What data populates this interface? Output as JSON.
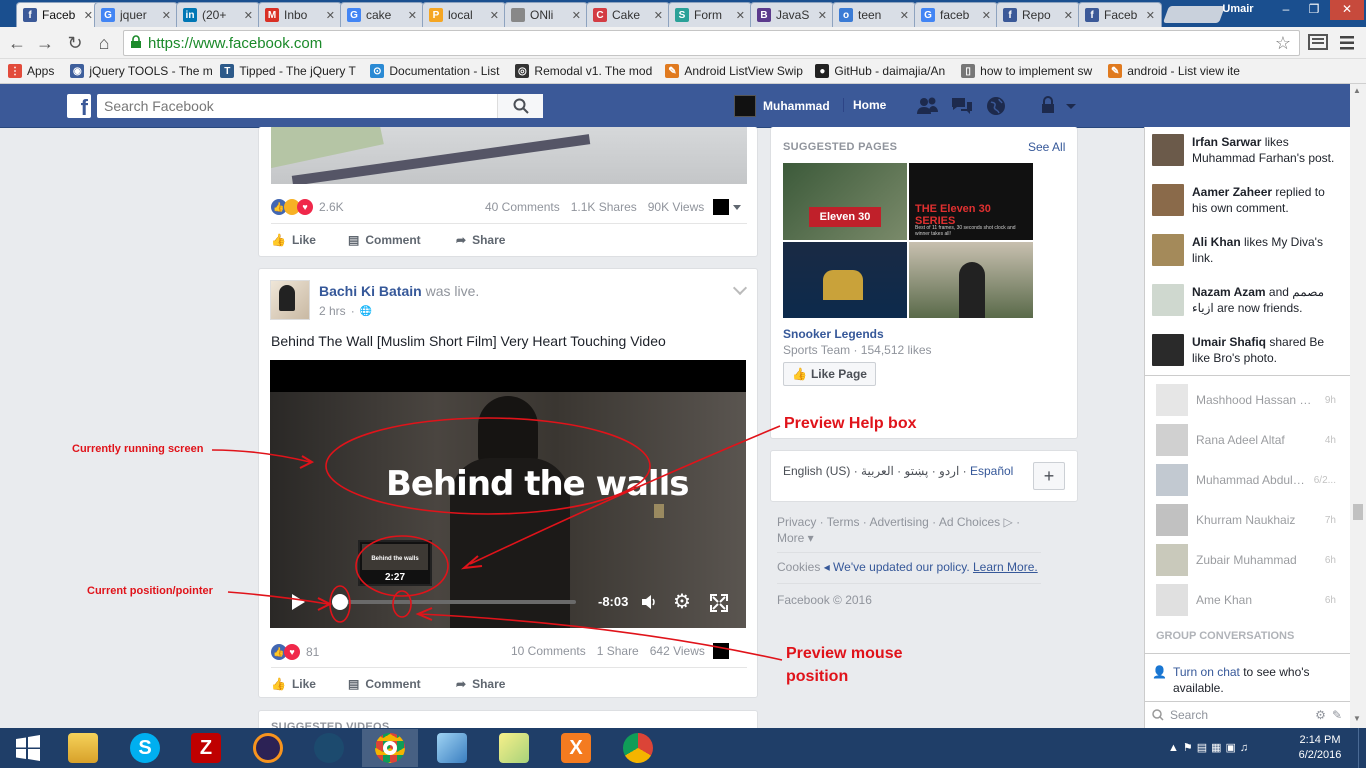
{
  "browser": {
    "tabs": [
      {
        "label": "Faceb",
        "icon": "facebook-icon",
        "color": "#3b5998",
        "glyph": "f"
      },
      {
        "label": "jquer",
        "icon": "google-icon",
        "color": "#4285f4",
        "glyph": "G"
      },
      {
        "label": "(20+",
        "icon": "linkedin-icon",
        "color": "#0077b5",
        "glyph": "in"
      },
      {
        "label": "Inbo",
        "icon": "gmail-icon",
        "color": "#d93025",
        "glyph": "M"
      },
      {
        "label": "cake",
        "icon": "google-icon",
        "color": "#4285f4",
        "glyph": "G"
      },
      {
        "label": "local",
        "icon": "phpmyadmin-icon",
        "color": "#f5a623",
        "glyph": "P"
      },
      {
        "label": "ONli",
        "icon": "document-icon",
        "color": "#888888",
        "glyph": ""
      },
      {
        "label": "Cake",
        "icon": "cakephp-icon",
        "color": "#d33c43",
        "glyph": "C"
      },
      {
        "label": "Form",
        "icon": "form-icon",
        "color": "#2aa198",
        "glyph": "S"
      },
      {
        "label": "JavaS",
        "icon": "javascript-icon",
        "color": "#5b3a8c",
        "glyph": "B"
      },
      {
        "label": "teen",
        "icon": "teen-icon",
        "color": "#3a7bd5",
        "glyph": "o"
      },
      {
        "label": "faceb",
        "icon": "google-icon",
        "color": "#4285f4",
        "glyph": "G"
      },
      {
        "label": "Repo",
        "icon": "facebook-icon",
        "color": "#3b5998",
        "glyph": "f"
      },
      {
        "label": "Faceb",
        "icon": "facebook-icon",
        "color": "#3b5998",
        "glyph": "f"
      }
    ],
    "profile_name": "Umair",
    "url": "https://www.facebook.com",
    "bookmarks": [
      {
        "label": "Apps",
        "color": "#e24b3b",
        "glyph": "⋮"
      },
      {
        "label": "jQuery TOOLS - The m",
        "color": "#3e5f9c",
        "glyph": "◉"
      },
      {
        "label": "Tipped - The jQuery T",
        "color": "#2d5a8a",
        "glyph": "T"
      },
      {
        "label": "Documentation - List",
        "color": "#2a8ad4",
        "glyph": "⊙"
      },
      {
        "label": "Remodal v1. The mod",
        "color": "#333333",
        "glyph": "◎"
      },
      {
        "label": "Android ListView Swip",
        "color": "#e07a1f",
        "glyph": "✎"
      },
      {
        "label": "GitHub - daimajia/An",
        "color": "#222222",
        "glyph": "●"
      },
      {
        "label": "how to implement sw",
        "color": "#777777",
        "glyph": "▯"
      },
      {
        "label": "android - List view ite",
        "color": "#e07a1f",
        "glyph": "✎"
      }
    ]
  },
  "fb": {
    "search_placeholder": "Search Facebook",
    "user_name": "Muhammad",
    "home_label": "Home"
  },
  "post1": {
    "reactions_count": "2.6K",
    "comments": "40 Comments",
    "shares": "1.1K Shares",
    "views": "90K Views",
    "like": "Like",
    "comment": "Comment",
    "share": "Share"
  },
  "post2": {
    "author": "Bachi Ki Batain",
    "status": "was live.",
    "time": "2 hrs",
    "text": "Behind The Wall [Muslim Short Film] Very Heart Touching Video",
    "video_title_overlay": "Behind the walls",
    "preview_time": "2:27",
    "preview_title": "Behind the walls",
    "remaining_time": "-8:03",
    "reactions_count": "81",
    "comments": "10 Comments",
    "shares": "1 Share",
    "views": "642 Views",
    "like": "Like",
    "comment": "Comment",
    "share": "Share",
    "suggested_videos": "SUGGESTED VIDEOS"
  },
  "suggested_pages": {
    "title": "SUGGESTED PAGES",
    "see_all": "See All",
    "thumb_text_1": "Eleven 30",
    "thumb_text_2": "THE Eleven 30 SERIES",
    "thumb_caption_2": "Best of 11 frames, 30 seconds shot clock and winner takes all!",
    "page_name": "Snooker Legends",
    "page_meta": "Sports Team · 154,512 likes",
    "like_page": "Like Page"
  },
  "languages": {
    "text": "English (US) · اردو · پښتو · العربية ·",
    "espanol": "Español",
    "add": "+"
  },
  "footer": {
    "links": "Privacy · Terms · Advertising · Ad Choices ▷ ·",
    "more": "More ▾",
    "cookies_label": "Cookies",
    "cookies_text": "◂ We've updated our policy.",
    "learn_more": "Learn More.",
    "copyright": "Facebook © 2016"
  },
  "ticker": [
    {
      "name": "Irfan Sarwar",
      "text": " likes Muhammad Farhan's post."
    },
    {
      "name": "Aamer Zaheer",
      "text": " replied to his own comment."
    },
    {
      "name": "Ali Khan",
      "text": " likes My Diva's link."
    },
    {
      "name": "Nazam Azam",
      "text": " and مصمم ازياء are now friends."
    },
    {
      "name": "Umair Shafiq",
      "text": " shared Be like Bro's photo."
    }
  ],
  "chat": {
    "contacts": [
      {
        "name": "Mashhood Hassan G...",
        "time": "9h"
      },
      {
        "name": "Rana Adeel Altaf",
        "time": "4h"
      },
      {
        "name": "Muhammad Abdulla...",
        "time": "6/2..."
      },
      {
        "name": "Khurram Naukhaiz",
        "time": "7h"
      },
      {
        "name": "Zubair Muhammad",
        "time": "6h"
      },
      {
        "name": "Ame Khan",
        "time": "6h"
      }
    ],
    "group_title": "GROUP CONVERSATIONS",
    "turn_on": "Turn on chat",
    "turn_on_rest": " to see who's available.",
    "search": "Search"
  },
  "annotations": {
    "running_screen": "Currently running screen",
    "preview_help": "Preview Help box",
    "current_pos": "Current position/pointer",
    "preview_mouse": "Preview mouse position"
  },
  "taskbar": {
    "time": "2:14 PM",
    "date": "6/2/2016"
  }
}
